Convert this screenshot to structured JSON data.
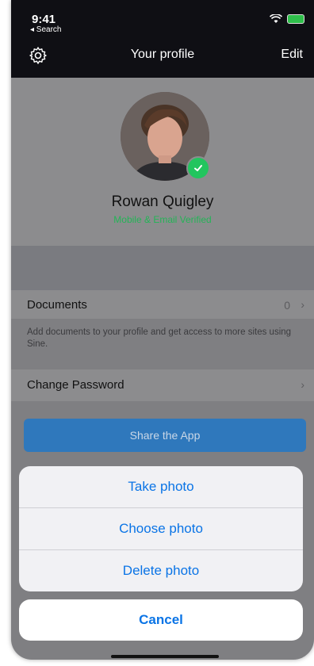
{
  "status": {
    "time": "9:41",
    "back": "◂ Search"
  },
  "header": {
    "title": "Your profile",
    "edit_label": "Edit",
    "icon": "gear-icon"
  },
  "profile": {
    "name": "Rowan Quigley",
    "verified": "Mobile & Email Verified",
    "badge_icon": "checkmark-icon"
  },
  "documents": {
    "label": "Documents",
    "count": "0",
    "hint": "Add documents to your profile and get access to more sites using Sine."
  },
  "change_password": {
    "label": "Change Password"
  },
  "share": {
    "label": "Share the App"
  },
  "action_sheet": {
    "options": [
      "Take photo",
      "Choose photo",
      "Delete photo"
    ],
    "cancel": "Cancel"
  },
  "colors": {
    "accent": "#0a74e6",
    "verified": "#24b457",
    "header": "#0f0f14",
    "share": "#2f78bc"
  }
}
